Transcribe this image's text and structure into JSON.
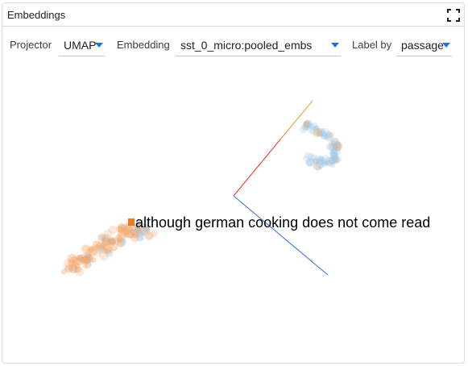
{
  "panel": {
    "title": "Embeddings",
    "fullscreen_icon": "fullscreen-icon"
  },
  "toolbar": {
    "projector_label": "Projector",
    "projector_value": "UMAP",
    "embedding_label": "Embedding",
    "embedding_value": "sst_0_micro:pooled_embs",
    "label_by_label": "Label by",
    "label_by_value": "passage"
  },
  "plot": {
    "hover_label": "although german cooking does not come read",
    "colors": {
      "orange": "#f5a66a",
      "blue": "#9cc4e4",
      "selected": "#f07b14",
      "axis_red": "#e23b2e",
      "axis_blue": "#2f6fe0",
      "axis_orange": "#f29a2e"
    }
  }
}
